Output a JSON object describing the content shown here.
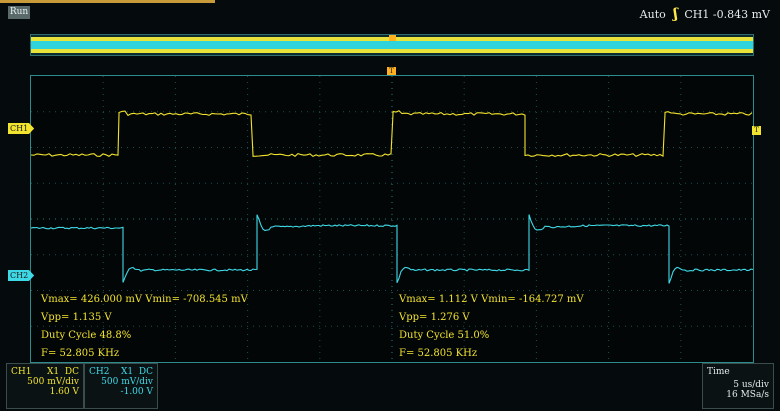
{
  "header": {
    "run_status": "Run",
    "trigger_mode": "Auto",
    "trigger_channel": "CH1",
    "trigger_level": "-0.843 mV"
  },
  "markers": {
    "trigger_top": "T",
    "ch1": "CH1",
    "ch2": "CH2",
    "trigger_level_right": "T"
  },
  "measurements": {
    "ch1_left": {
      "vmax_vmin": "Vmax= 426.000 mV  Vmin= -708.545 mV",
      "vpp": "Vpp= 1.135 V",
      "duty": "Duty Cycle 48.8%",
      "freq": "F= 52.805 KHz"
    },
    "ch2_right": {
      "vmax_vmin": "Vmax= 1.112 V  Vmin= -164.727 mV",
      "vpp": "Vpp= 1.276 V",
      "duty": "Duty Cycle 51.0%",
      "freq": "F= 52.805 KHz"
    }
  },
  "channel_panels": {
    "ch1": {
      "name": "CH1",
      "probe": "X1",
      "coupling": "DC",
      "scale": "500 mV/div",
      "offset": "1.60 V"
    },
    "ch2": {
      "name": "CH2",
      "probe": "X1",
      "coupling": "DC",
      "scale": "500 mV/div",
      "offset": "-1.00 V"
    }
  },
  "time_panel": {
    "title": "Time",
    "timebase": "5 us/div",
    "sample_rate": "16 MSa/s"
  },
  "colors": {
    "ch1": "#f2e32e",
    "ch2": "#3ed9e6",
    "grid": "#2c8b8c",
    "background": "#030607"
  }
}
